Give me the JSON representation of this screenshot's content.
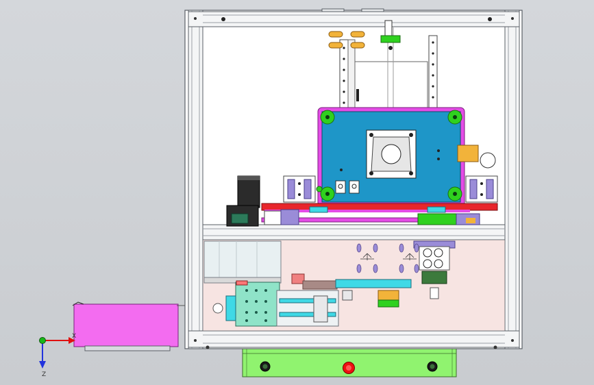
{
  "viewport": {
    "background_top": "#d4d7db",
    "background_bottom": "#c9ccd0"
  },
  "colors": {
    "frame": "#f4f5f6",
    "frame_edge": "#5a5f66",
    "lower_panel": "#f7e4e2",
    "carriage_plate": "#1e96c8",
    "carriage_border": "#e44ce6",
    "rail_red": "#e8262b",
    "rail_magenta": "#e44ce6",
    "green_block": "#2fd11f",
    "cyan_part": "#3fd9e6",
    "mint_part": "#8fe3c8",
    "lavender_part": "#9a8cd8",
    "orange_part": "#f2b33a",
    "pink_box": "#f36cf0",
    "base_green": "#90f36f",
    "red_button": "#ee1111",
    "axis_red": "#e01010",
    "axis_blue": "#2233dd",
    "axis_green": "#18b818"
  },
  "axis_triad": {
    "x_label": "X",
    "z_label": "Z"
  },
  "icons": {
    "triad": "coordinate-triad-icon",
    "stop_button": "emergency-stop-icon",
    "black_buttons": "push-button-icon"
  }
}
